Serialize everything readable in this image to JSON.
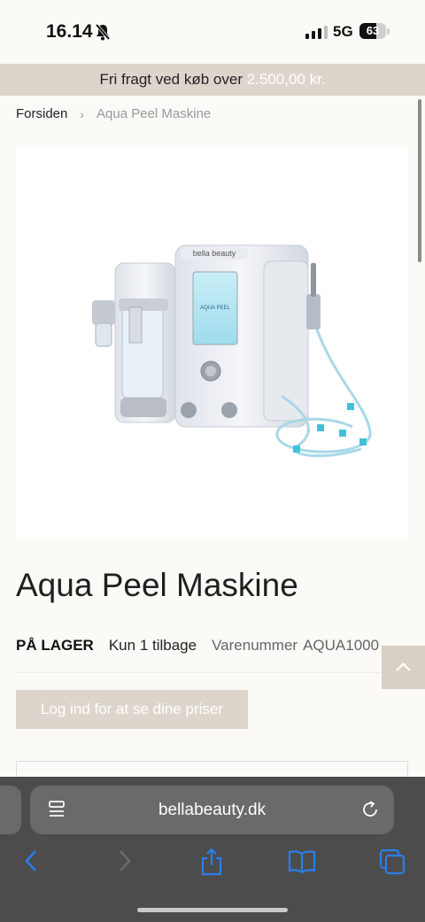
{
  "status": {
    "time": "16.14",
    "network": "5G",
    "battery": "63",
    "battery_level": 0.63,
    "signal_bars": 3,
    "silent_icon": "bell-slash-icon"
  },
  "promo": {
    "text": "Fri fragt ved køb over ",
    "amount": "2.500,00 kr."
  },
  "breadcrumb": {
    "home": "Forsiden",
    "separator": "›",
    "current": "Aqua Peel Maskine"
  },
  "product": {
    "image_alt": "Aqua Peel machine",
    "image_brand": "bella beauty",
    "image_screen": "AQUA PEEL",
    "title": "Aqua Peel Maskine",
    "stock": "PÅ LAGER",
    "stock_note": "Kun 1 tilbage",
    "sku_label": "Varenummer",
    "sku": "AQUA1000"
  },
  "actions": {
    "login_prices": "Log ind for at se dine priser",
    "scroll_top_icon": "chevron-up-icon"
  },
  "browser": {
    "url": "bellabeauty.dk",
    "toolbar_icons": [
      "back-icon",
      "forward-icon",
      "share-icon",
      "bookmarks-icon",
      "tabs-icon"
    ]
  },
  "colors": {
    "promo_bg": "#ddd5cb",
    "accent": "#2b7de9",
    "browser_bg": "#4c4c4d"
  }
}
